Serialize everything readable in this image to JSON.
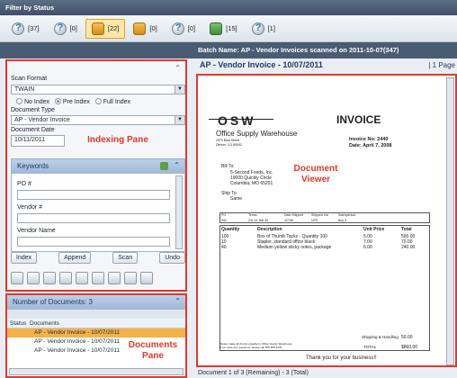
{
  "header": {
    "title": "Filter by Status"
  },
  "toolbar": {
    "buttons": [
      {
        "count": "[37]",
        "icon": "question-icon",
        "selected": false
      },
      {
        "count": "[0]",
        "icon": "question-icon",
        "selected": false
      },
      {
        "count": "[22]",
        "icon": "user-edit-icon",
        "selected": true
      },
      {
        "count": "[0]",
        "icon": "user-edit-icon",
        "selected": false
      },
      {
        "count": "[0]",
        "icon": "question-icon",
        "selected": false
      },
      {
        "count": "[15]",
        "icon": "check-doc-icon",
        "selected": false
      },
      {
        "count": "[1]",
        "icon": "question-icon",
        "selected": false
      }
    ]
  },
  "batch": {
    "name": "Batch Name: AP - Vendor Invoices scanned on 2011-10-07(347)"
  },
  "indexing": {
    "scan_format_label": "Scan Format",
    "scan_format_value": "TWAIN",
    "radio_no_index": "No Index",
    "radio_pre_index": "Pre Index",
    "radio_full_index": "Full Index",
    "doc_type_label": "Document Type",
    "doc_type_value": "AP - Vendor Invoice",
    "doc_date_label": "Document Date",
    "doc_date_value": "10/11/2011",
    "note": "Indexing Pane",
    "keywords_title": "Keywords",
    "fields": [
      {
        "label": "PO #",
        "value": ""
      },
      {
        "label": "Vendor #",
        "value": ""
      },
      {
        "label": "Vendor Name",
        "value": ""
      }
    ],
    "buttons": {
      "index": "Index",
      "append": "Append",
      "scan": "Scan",
      "undo": "Undo"
    }
  },
  "documents": {
    "title": "Number of Documents: 3",
    "col_status": "Status",
    "col_documents": "Documents",
    "rows": [
      "AP - Vendor Invoice - 10/07/2011",
      "AP - Vendor Invoice - 10/07/2011",
      "AP - Vendor Invoice - 10/07/2011"
    ],
    "note": "Documents Pane"
  },
  "viewer": {
    "title": "AP - Vendor Invoice - 10/07/2011",
    "page": "1 Page",
    "note": "Document Viewer",
    "status": "Document 1 of 3 (Remaining) - 3 (Total)"
  },
  "invoice": {
    "logo": "OSW",
    "company": "Office Supply Warehouse",
    "addr1": "2579 Blue Street",
    "addr2": "Denver, CO 80002",
    "heading": "INVOICE",
    "inv_no": "Invoice No: 2440",
    "inv_date": "Date: April 7, 2008",
    "bill_to": "Bill To:",
    "bill1": "5-Second Foods, Inc.",
    "bill2": "19000 Quickly Circle",
    "bill3": "Columbia, MO 65201",
    "ship_to": "Ship To:",
    "ship1": "Same",
    "terms_hdr": [
      "PO",
      "Terms",
      "Date Shipped",
      "Shipped Via",
      "Salesperson"
    ],
    "terms_row": [
      "992",
      "2% 10, Net 30",
      "4/7/08",
      "UPS",
      "Buy It"
    ],
    "items_hdr": [
      "Quantity",
      "Description",
      "Unit Price",
      "Total"
    ],
    "items": [
      [
        "100",
        "Box of Thumb Tacks - Quantity 100",
        "5.00",
        "500.00"
      ],
      [
        "10",
        "Stapler, standard office black",
        "7.00",
        "70.00"
      ],
      [
        "40",
        "Medium yellow sticky notes, package",
        "6.00",
        "240.00"
      ]
    ],
    "shipping_label": "Shipping & Handling",
    "shipping_value": "50.00",
    "total_label": "TOTAL",
    "total_value": "$860.00",
    "foot1": "Please make all checks payable to Office Supply Warehouse",
    "foot2": "If you have any questions, please call 555-555-1234",
    "thanks": "Thank you for your business!!"
  }
}
